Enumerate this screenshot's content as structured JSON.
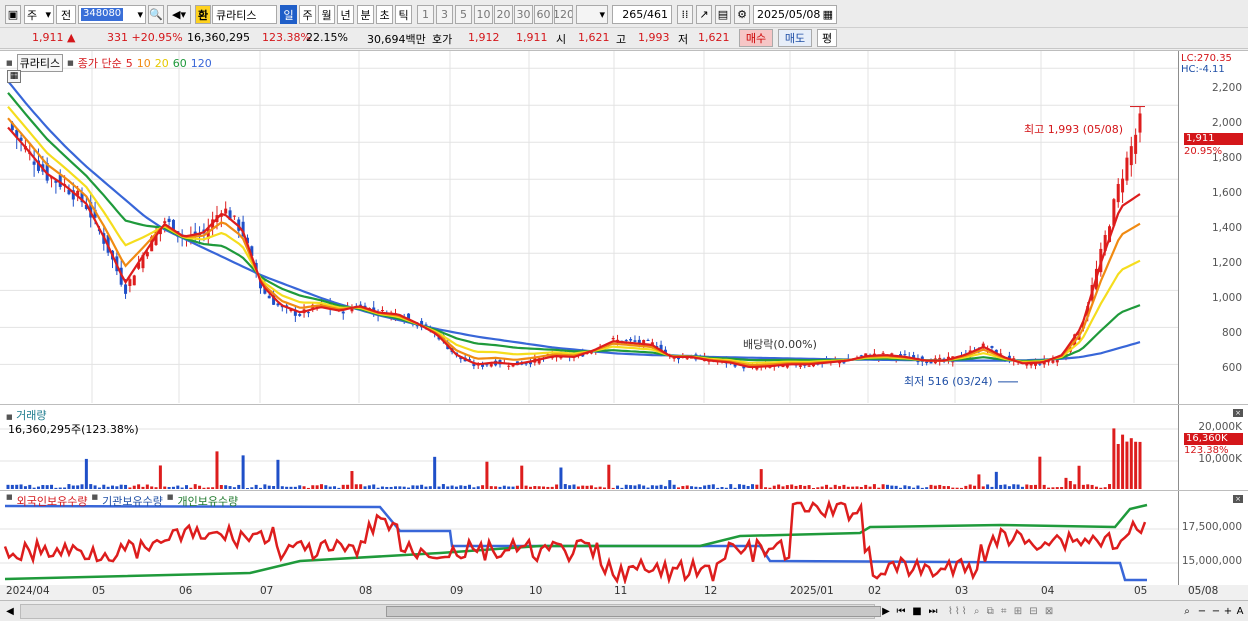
{
  "toolbar": {
    "type_sel": "주",
    "scope_sel": "전",
    "code": "348080",
    "exchange_badge": "환",
    "stock_name": "큐라티스",
    "periods": [
      "일",
      "주",
      "월",
      "년",
      "분",
      "초",
      "틱"
    ],
    "intervals": [
      "1",
      "3",
      "5",
      "10",
      "20",
      "30",
      "60",
      "120"
    ],
    "count": "265",
    "count_total": "/461",
    "date": "2025/05/08"
  },
  "status": {
    "price": "1,911 ▲",
    "change": "331 +20.95%",
    "volume": "16,360,295",
    "volume_ratio": "123.38%",
    "turnover": "22.15%",
    "amount": "30,694백만",
    "quote_label": "호가",
    "quote_val": "1,912",
    "quote_val2": "1,911",
    "open_label": "시",
    "open": "1,621",
    "high_label": "고",
    "high": "1,993",
    "low_label": "저",
    "low": "1,621",
    "buy": "매수",
    "sell": "매도",
    "eval": "평"
  },
  "price_panel": {
    "stock_label": "큐라티스",
    "legend_prefix": "종가 단순",
    "ma_periods": [
      "5",
      "10",
      "20",
      "60",
      "120"
    ],
    "ma_colors": [
      "#dd1d1d",
      "#f08a12",
      "#f5dd1e",
      "#1f9a3b",
      "#3866d8"
    ],
    "lc": "LC:270.35",
    "hc": "HC:-4.11",
    "y_ticks": [
      "2,200",
      "2,000",
      "1,800",
      "1,600",
      "1,400",
      "1,200",
      "1,000",
      "800",
      "600"
    ],
    "last_price": "1,911",
    "last_pct": "20.95%",
    "high_annot": "최고 1,993 (05/08)",
    "low_annot": "최저 516 (03/24)",
    "div_annot": "배당락(0.00%)"
  },
  "volume_panel": {
    "title": "거래량",
    "value": "16,360,295주(123.38%)",
    "y_ticks": [
      "20,000K",
      "10,000K"
    ],
    "last": "16,360K",
    "last_pct": "123.38%"
  },
  "holdings_panel": {
    "legend": [
      "외국인보유수량",
      "기관보유수량",
      "개인보유수량"
    ],
    "legend_colors": [
      "#dd1d1d",
      "#3866d8",
      "#1f9a3b"
    ],
    "y_ticks": [
      "17,500,000",
      "15,000,000"
    ]
  },
  "x_axis": [
    "2024/04",
    "05",
    "06",
    "07",
    "08",
    "09",
    "10",
    "11",
    "12",
    "2025/01",
    "02",
    "03",
    "04",
    "05",
    "05/08"
  ],
  "chart_data": {
    "type": "candlestick",
    "series": [
      {
        "name": "종가",
        "values": [
          1900,
          1750,
          1620,
          1560,
          1460,
          1250,
          1000,
          1210,
          1380,
          1280,
          1300,
          1450,
          1320,
          1000,
          900,
          870,
          920,
          890,
          920,
          880,
          870,
          820,
          760,
          640,
          590,
          610,
          600,
          620,
          650,
          640,
          680,
          730,
          720,
          710,
          640,
          640,
          620,
          610,
          580,
          590,
          600,
          600,
          610,
          620,
          650,
          650,
          640,
          620,
          620,
          650,
          700,
          640,
          600,
          610,
          640,
          800,
          1200,
          1600,
          1911
        ]
      },
      {
        "name": "5",
        "values": [
          1880,
          1760,
          1630,
          1560,
          1470,
          1270,
          1040,
          1200,
          1360,
          1290,
          1310,
          1420,
          1330,
          1030,
          920,
          880,
          910,
          890,
          915,
          880,
          870,
          820,
          760,
          650,
          600,
          610,
          600,
          620,
          645,
          640,
          675,
          725,
          715,
          705,
          640,
          640,
          620,
          610,
          585,
          590,
          600,
          600,
          610,
          620,
          645,
          650,
          640,
          620,
          620,
          650,
          695,
          640,
          605,
          610,
          650,
          800,
          1150,
          1450,
          1520
        ]
      },
      {
        "name": "120",
        "values": [
          2130,
          2000,
          1880,
          1770,
          1670,
          1580,
          1490,
          1400,
          1330,
          1280,
          1230,
          1180,
          1130,
          1080,
          1040,
          1000,
          960,
          925,
          895,
          865,
          840,
          815,
          790,
          770,
          750,
          735,
          720,
          705,
          690,
          680,
          670,
          660,
          655,
          650,
          648,
          645,
          640,
          638,
          636,
          634,
          632,
          630,
          628,
          626,
          625,
          624,
          623,
          622,
          621,
          620,
          620,
          620,
          622,
          625,
          630,
          640,
          660,
          690,
          720
        ]
      }
    ],
    "price_range": [
      510,
      2250
    ]
  }
}
